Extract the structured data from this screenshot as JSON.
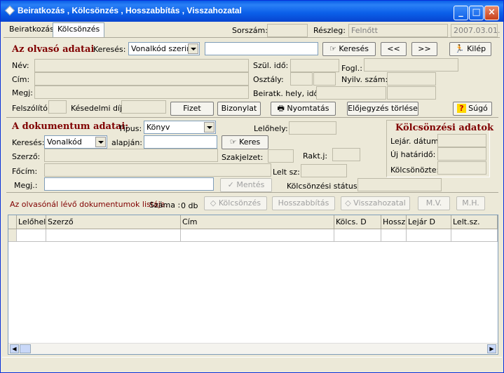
{
  "window": {
    "title": "Beiratkozás , Kölcsönzés , Hosszabbítás , Visszahozatal"
  },
  "tabs": [
    {
      "label": "Beiratkozás"
    },
    {
      "label": "Kölcsönzés"
    }
  ],
  "header": {
    "sorszam_label": "Sorszám:",
    "reszleg_label": "Részleg:",
    "reszleg_value": "Felnőtt",
    "date": "2007.03.01."
  },
  "reader": {
    "section_title": "Az olvasó adatai",
    "search_label": "Keresés:",
    "search_mode": "Vonalkód szerint",
    "search_button": "Keresés",
    "prev_button": "<<",
    "next_button": ">>",
    "exit_button": "Kilép",
    "nev_label": "Név:",
    "cim_label": "Cím:",
    "megj_label": "Megj:",
    "szul_ido_label": "Szül. idő:",
    "fogl_label": "Fogl.:",
    "osztaly_label": "Osztály:",
    "nyilv_szam_label": "Nyilv. szám:",
    "beiratk_label": "Beiratk. hely, idő:",
    "felszolito_label": "Felszólító:",
    "kesedelmi_label": "Késedelmi díj:",
    "fizet_button": "Fizet",
    "bizonylat_button": "Bizonylat",
    "nyomtatas_button": "Nyomtatás",
    "elojegyzes_button": "Előjegyzés törlése",
    "sugo_button": "Súgó"
  },
  "document": {
    "section_title": "A dokumentum adatai:",
    "tipus_label": "Típus:",
    "tipus_value": "Könyv",
    "lelohely_label": "Lelőhely:",
    "kereses_label": "Keresés:",
    "kereses_mode": "Vonalkód",
    "alapjan_label": "alapján:",
    "keres_button": "Keres",
    "szerzo_label": "Szerző:",
    "szakjelzet_label": "Szakjelzet:",
    "raktj_label": "Rakt.j:",
    "focim_label": "Főcím:",
    "lelt_sz_label": "Lelt sz:",
    "megj_label": "Megj.:",
    "mentes_button": "Mentés",
    "status_label": "Kölcsönzési státusz:"
  },
  "loan": {
    "section_title": "Kölcsönzési adatok",
    "lejar_label": "Lejár. dátum:",
    "uj_hatarido_label": "Új határidő:",
    "kolcsonozte_label": "Kölcsönözte:"
  },
  "listbar": {
    "title": "Az olvasónál lévő dokumentumok listája.",
    "count_label": "Száma :",
    "count_value": "0 db",
    "kolcsonzes_button": "Kölcsönzés",
    "hosszabbitas_button": "Hosszabbítás",
    "visszahozatal_button": "Visszahozatal",
    "mv_button": "M.V.",
    "mh_button": "M.H."
  },
  "grid": {
    "columns": [
      "Lelőhely",
      "Szerző",
      "Cím",
      "Kölcs. D",
      "Hossz.",
      "Lejár D",
      "Lelt.sz."
    ]
  }
}
